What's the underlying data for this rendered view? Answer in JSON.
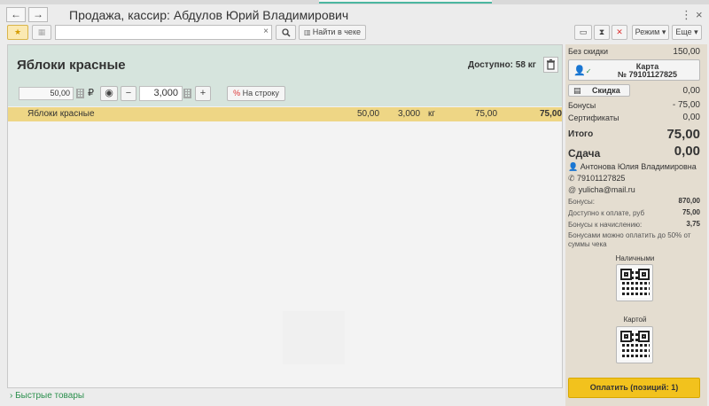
{
  "window": {
    "title": "Продажа, кассир: Абдулов Юрий Владимирович",
    "back_icon": "arrow-left-icon",
    "forward_icon": "arrow-right-icon"
  },
  "toolbar": {
    "search_value": "",
    "clear_glyph": "×",
    "find_in_receipt": "Найти в чеке",
    "mode": "Режим",
    "more": "Еще"
  },
  "product": {
    "name": "Яблоки красные",
    "available": "Доступно: 58 кг",
    "price": "50,00",
    "currency": "₽",
    "quantity": "3,000",
    "minus": "−",
    "plus": "+",
    "to_row_icon": "%",
    "to_row": "На строку"
  },
  "receipt": {
    "rows": [
      {
        "name": "Яблоки красные",
        "price": "50,00",
        "qty": "3,000",
        "unit": "кг",
        "sum": "75,00",
        "total": "75,00"
      }
    ]
  },
  "summary": {
    "no_discount_label": "Без скидки",
    "no_discount_value": "150,00",
    "card_title": "Карта",
    "card_number": "№ 79101127825",
    "discount_label": "Скидка",
    "discount_value": "0,00",
    "bonuses_label": "Бонусы",
    "bonuses_value": "- 75,00",
    "certs_label": "Сертификаты",
    "certs_value": "0,00",
    "total_label": "Итого",
    "total_value": "75,00",
    "change_label": "Сдача",
    "change_value": "0,00"
  },
  "customer": {
    "name": "Антонова Юлия Владимировна",
    "phone": "79101127825",
    "email": "yulicha@mail.ru",
    "bonuses_label": "Бонусы:",
    "bonuses_value": "870,00",
    "available_label": "Доступно к оплате, руб",
    "available_value": "75,00",
    "accrual_label": "Бонусы к начислению:",
    "accrual_value": "3,75",
    "note": "Бонусами можно оплатить до 50% от суммы чека"
  },
  "payment": {
    "cash_label": "Наличными",
    "card_label": "Картой",
    "pay_button": "Оплатить (позиций: 1)"
  },
  "footer": {
    "quick_goods": "Быстрые товары"
  },
  "colors": {
    "accent": "#f2c21d",
    "selected_row": "#eed685",
    "product_panel": "#d6e4dd",
    "link_green": "#2a8f4c"
  }
}
